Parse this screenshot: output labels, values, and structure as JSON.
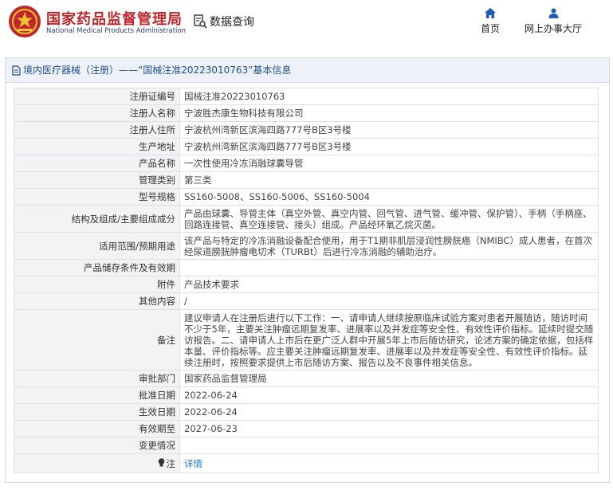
{
  "header": {
    "logo_cn": "国家药品监督管理局",
    "logo_en": "National Medical Products Administration",
    "search_label": "数据查询",
    "nav": [
      {
        "label": "首页",
        "icon": "home-icon"
      },
      {
        "label": "网上办事大厅",
        "icon": "user-icon"
      }
    ]
  },
  "breadcrumb": {
    "text": "境内医疗器械（注册）——“国械注准20223010763”基本信息"
  },
  "rows": [
    {
      "label": "注册证编号",
      "value": "国械注准20223010763"
    },
    {
      "label": "注册人名称",
      "value": "宁波胜杰康生物科技有限公司"
    },
    {
      "label": "注册人住所",
      "value": "宁波杭州湾新区滨海四路777号B区3号楼"
    },
    {
      "label": "生产地址",
      "value": "宁波杭州湾新区滨海四路777号B区3号楼"
    },
    {
      "label": "产品名称",
      "value": "一次性使用冷冻消融球囊导管"
    },
    {
      "label": "管理类别",
      "value": "第三类"
    },
    {
      "label": "型号规格",
      "value": "SS160-5008、SS160-5006、SS160-5004"
    },
    {
      "label": "结构及组成/主要组成成分",
      "value": "产品由球囊、导管主体（真空外管、真空内管、回气管、进气管、缓冲管、保护管）、手柄（手柄座、回路连接管、真空连接管、接头）组成。产品经环氧乙烷灭菌。"
    },
    {
      "label": "适用范围/预期用途",
      "value": "该产品与特定的冷冻消融设备配合使用，用于T1期非肌层浸润性膀胱癌（NMIBC）成人患者，在首次经尿道膀胱肿瘤电切术（TURBt）后进行冷冻消融的辅助治疗。"
    },
    {
      "label": "产品储存条件及有效期",
      "value": ""
    },
    {
      "label": "附件",
      "value": "产品技术要求"
    },
    {
      "label": "其他内容",
      "value": "/"
    },
    {
      "label": "备注",
      "value": "建议申请人在注册后进行以下工作：一、请申请人继续按原临床试验方案对患者开展随访，随访时间不少于5年，主要关注肿瘤远期复发率、进展率以及并发症等安全性、有效性评价指标。延续时提交随访报告。二、请申请人上市后在更广泛人群中开展5年上市后随访研究，论述方案的确定依据，包括样本量、评价指标等。应主要关注肿瘤远期复发率、进展率以及并发症等安全性、有效性评价指标。延续注册时，按照要求提供上市后随访方案、报告以及不良事件相关信息。"
    },
    {
      "label": "审批部门",
      "value": "国家药品监督管理局"
    },
    {
      "label": "批准日期",
      "value": "2022-06-24"
    },
    {
      "label": "生效日期",
      "value": "2022-06-24"
    },
    {
      "label": "有效期至",
      "value": "2027-06-23"
    },
    {
      "label": "变更情况",
      "value": ""
    },
    {
      "label": "注",
      "value": "详情",
      "icon": "bulb-icon"
    }
  ]
}
